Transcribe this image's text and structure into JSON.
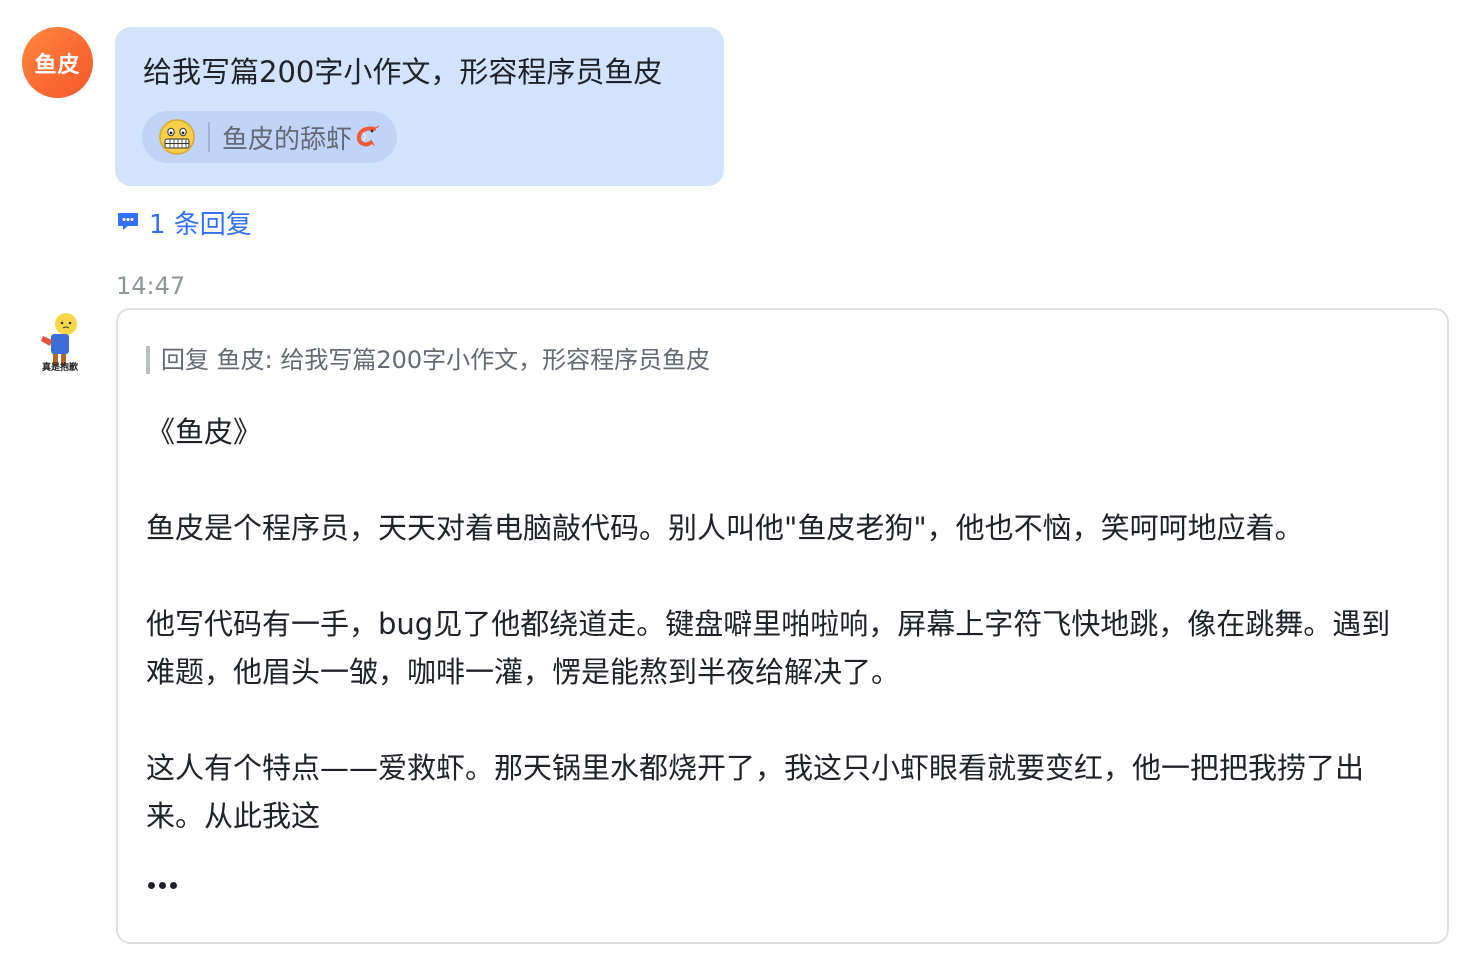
{
  "message_user": {
    "avatar_text": "鱼皮",
    "text": "给我写篇200字小作文，形容程序员鱼皮",
    "mention": {
      "icon": "grimacing-face-emoji",
      "label": "鱼皮的舔虾",
      "trailing_icon": "shrimp-emoji"
    },
    "reply_count_label": "1 条回复"
  },
  "timestamp": "14:47",
  "message_bot": {
    "avatar_caption": "真是抱歉",
    "quote": "回复 鱼皮: 给我写篇200字小作文，形容程序员鱼皮",
    "paragraphs": [
      "《鱼皮》",
      "鱼皮是个程序员，天天对着电脑敲代码。别人叫他\"鱼皮老狗\"，他也不恼，笑呵呵地应着。",
      "他写代码有一手，bug见了他都绕道走。键盘噼里啪啦响，屏幕上字符飞快地跳，像在跳舞。遇到难题，他眉头一皱，咖啡一灌，愣是能熬到半夜给解决了。",
      "这人有个特点——爱救虾。那天锅里水都烧开了，我这只小虾眼看就要变红，他一把把我捞了出来。从此我这"
    ],
    "more_icon": "ellipsis-icon"
  },
  "colors": {
    "bubble_bg": "#d2e3fc",
    "link_blue": "#3370ff",
    "avatar_orange": "#fb6a33"
  }
}
